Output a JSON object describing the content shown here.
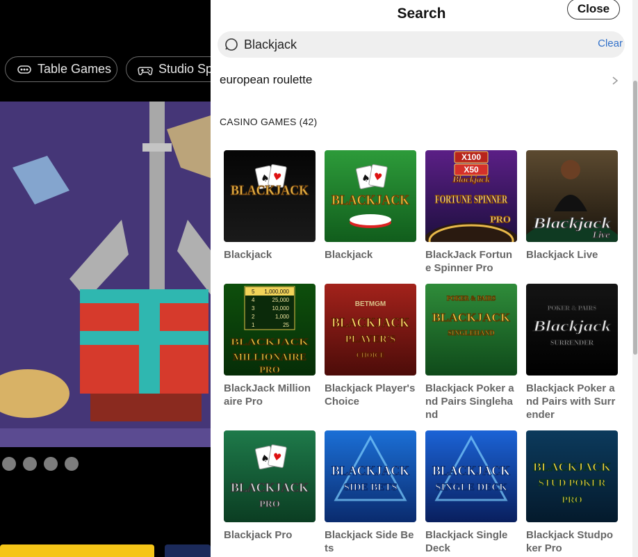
{
  "background": {
    "category_chips": [
      {
        "label": "Table Games",
        "icon": "table-games-icon"
      },
      {
        "label": "Studio Spo",
        "icon": "gamepad-icon"
      }
    ],
    "carousel_dots": 4
  },
  "search": {
    "title": "Search",
    "close_label": "Close",
    "query": "Blackjack",
    "clear_label": "Clear",
    "suggestion": "european roulette",
    "section_heading": "CASINO GAMES (42)"
  },
  "games": [
    {
      "title": "Blackjack",
      "art": "blackjack-surrender",
      "art_text": "BLACKJACK"
    },
    {
      "title": "Blackjack",
      "art": "blackjack-green",
      "art_text": "BLACKJACK"
    },
    {
      "title": "BlackJack Fortune Spinner Pro",
      "art": "fortune-spinner",
      "art_text": "FORTUNE SPINNER",
      "art_badges": [
        "X100",
        "X50"
      ],
      "art_script": "Blackjack",
      "art_suffix": "PRO"
    },
    {
      "title": "Blackjack Live",
      "art": "blackjack-live",
      "art_text": "Blackjack",
      "art_suffix": "Live"
    },
    {
      "title": "BlackJack Millionaire Pro",
      "art": "millionaire",
      "art_text": "BLACKJACK",
      "art_sub": "MILLIONAIRE",
      "art_suffix": "PRO",
      "art_ladder": [
        [
          "5",
          "1,000,000"
        ],
        [
          "4",
          "25,000"
        ],
        [
          "3",
          "10,000"
        ],
        [
          "2",
          "1,000"
        ],
        [
          "1",
          "25"
        ]
      ]
    },
    {
      "title": "Blackjack Player's Choice",
      "art": "players-choice",
      "art_text": "BLACKJACK",
      "art_sub": "PLAYER'S",
      "art_suffix": "CHOICE",
      "art_brand": "BETMGM"
    },
    {
      "title": "Blackjack Poker and Pairs Singlehand",
      "art": "poker-pairs-single",
      "art_text": "BLACKJACK",
      "art_sub": "POKER & PAIRS",
      "art_suffix": "SINGLEHAND"
    },
    {
      "title": "Blackjack Poker and Pairs with Surrender",
      "art": "poker-pairs-surrender",
      "art_text": "Blackjack",
      "art_sub": "POKER & PAIRS",
      "art_suffix": "SURRENDER"
    },
    {
      "title": "Blackjack Pro",
      "art": "blackjack-pro",
      "art_text": "BLACKJACK",
      "art_suffix": "PRO"
    },
    {
      "title": "Blackjack Side Bets",
      "art": "side-bets",
      "art_text": "BLACKJACK",
      "art_sub": "SIDE BETS"
    },
    {
      "title": "Blackjack Single Deck",
      "art": "single-deck",
      "art_text": "BLACKJACK",
      "art_sub": "SINGLE DECK"
    },
    {
      "title": "Blackjack Studpoker Pro",
      "art": "stud-poker",
      "art_text": "BLACKJACK",
      "art_sub": "STUD POKER",
      "art_suffix": "PRO"
    }
  ]
}
